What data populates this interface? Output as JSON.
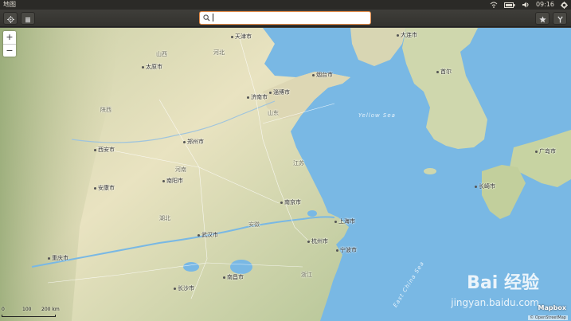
{
  "panel": {
    "app_title": "地图",
    "time": "09:16",
    "icons": [
      "wifi-icon",
      "battery-icon",
      "volume-icon",
      "gear-icon"
    ]
  },
  "toolbar": {
    "left_buttons": [
      "location-icon",
      "layers-icon"
    ],
    "search": {
      "value": "",
      "placeholder": ""
    },
    "right_buttons": [
      "star-icon",
      "route-icon"
    ]
  },
  "map": {
    "zoom_in": "+",
    "zoom_out": "−",
    "scale": {
      "zero": "0",
      "mid": "100",
      "max": "200 km"
    },
    "brand": "Mapbox",
    "attribution": "© OpenStreetMap",
    "watermark": {
      "logo": "Bai 经验",
      "url": "jingyan.baidu.com"
    },
    "sea_labels": {
      "yellow": "Yellow Sea",
      "east_china": "East China Sea"
    },
    "cities": [
      {
        "name": "天津市"
      },
      {
        "name": "太原市"
      },
      {
        "name": "济南市"
      },
      {
        "name": "淄博市"
      },
      {
        "name": "烟台市"
      },
      {
        "name": "西安市"
      },
      {
        "name": "郑州市"
      },
      {
        "name": "南阳市"
      },
      {
        "name": "安康市"
      },
      {
        "name": "南京市"
      },
      {
        "name": "上海市"
      },
      {
        "name": "武汉市"
      },
      {
        "name": "杭州市"
      },
      {
        "name": "宁波市"
      },
      {
        "name": "重庆市"
      },
      {
        "name": "南昌市"
      },
      {
        "name": "长沙市"
      },
      {
        "name": "大连市"
      },
      {
        "name": "首尔"
      },
      {
        "name": "广岛市"
      },
      {
        "name": "长崎市"
      }
    ],
    "provinces": [
      {
        "name": "河北"
      },
      {
        "name": "山西"
      },
      {
        "name": "山东"
      },
      {
        "name": "河南"
      },
      {
        "name": "江苏"
      },
      {
        "name": "安徽"
      },
      {
        "name": "湖北"
      },
      {
        "name": "陕西"
      },
      {
        "name": "浙江"
      }
    ]
  }
}
